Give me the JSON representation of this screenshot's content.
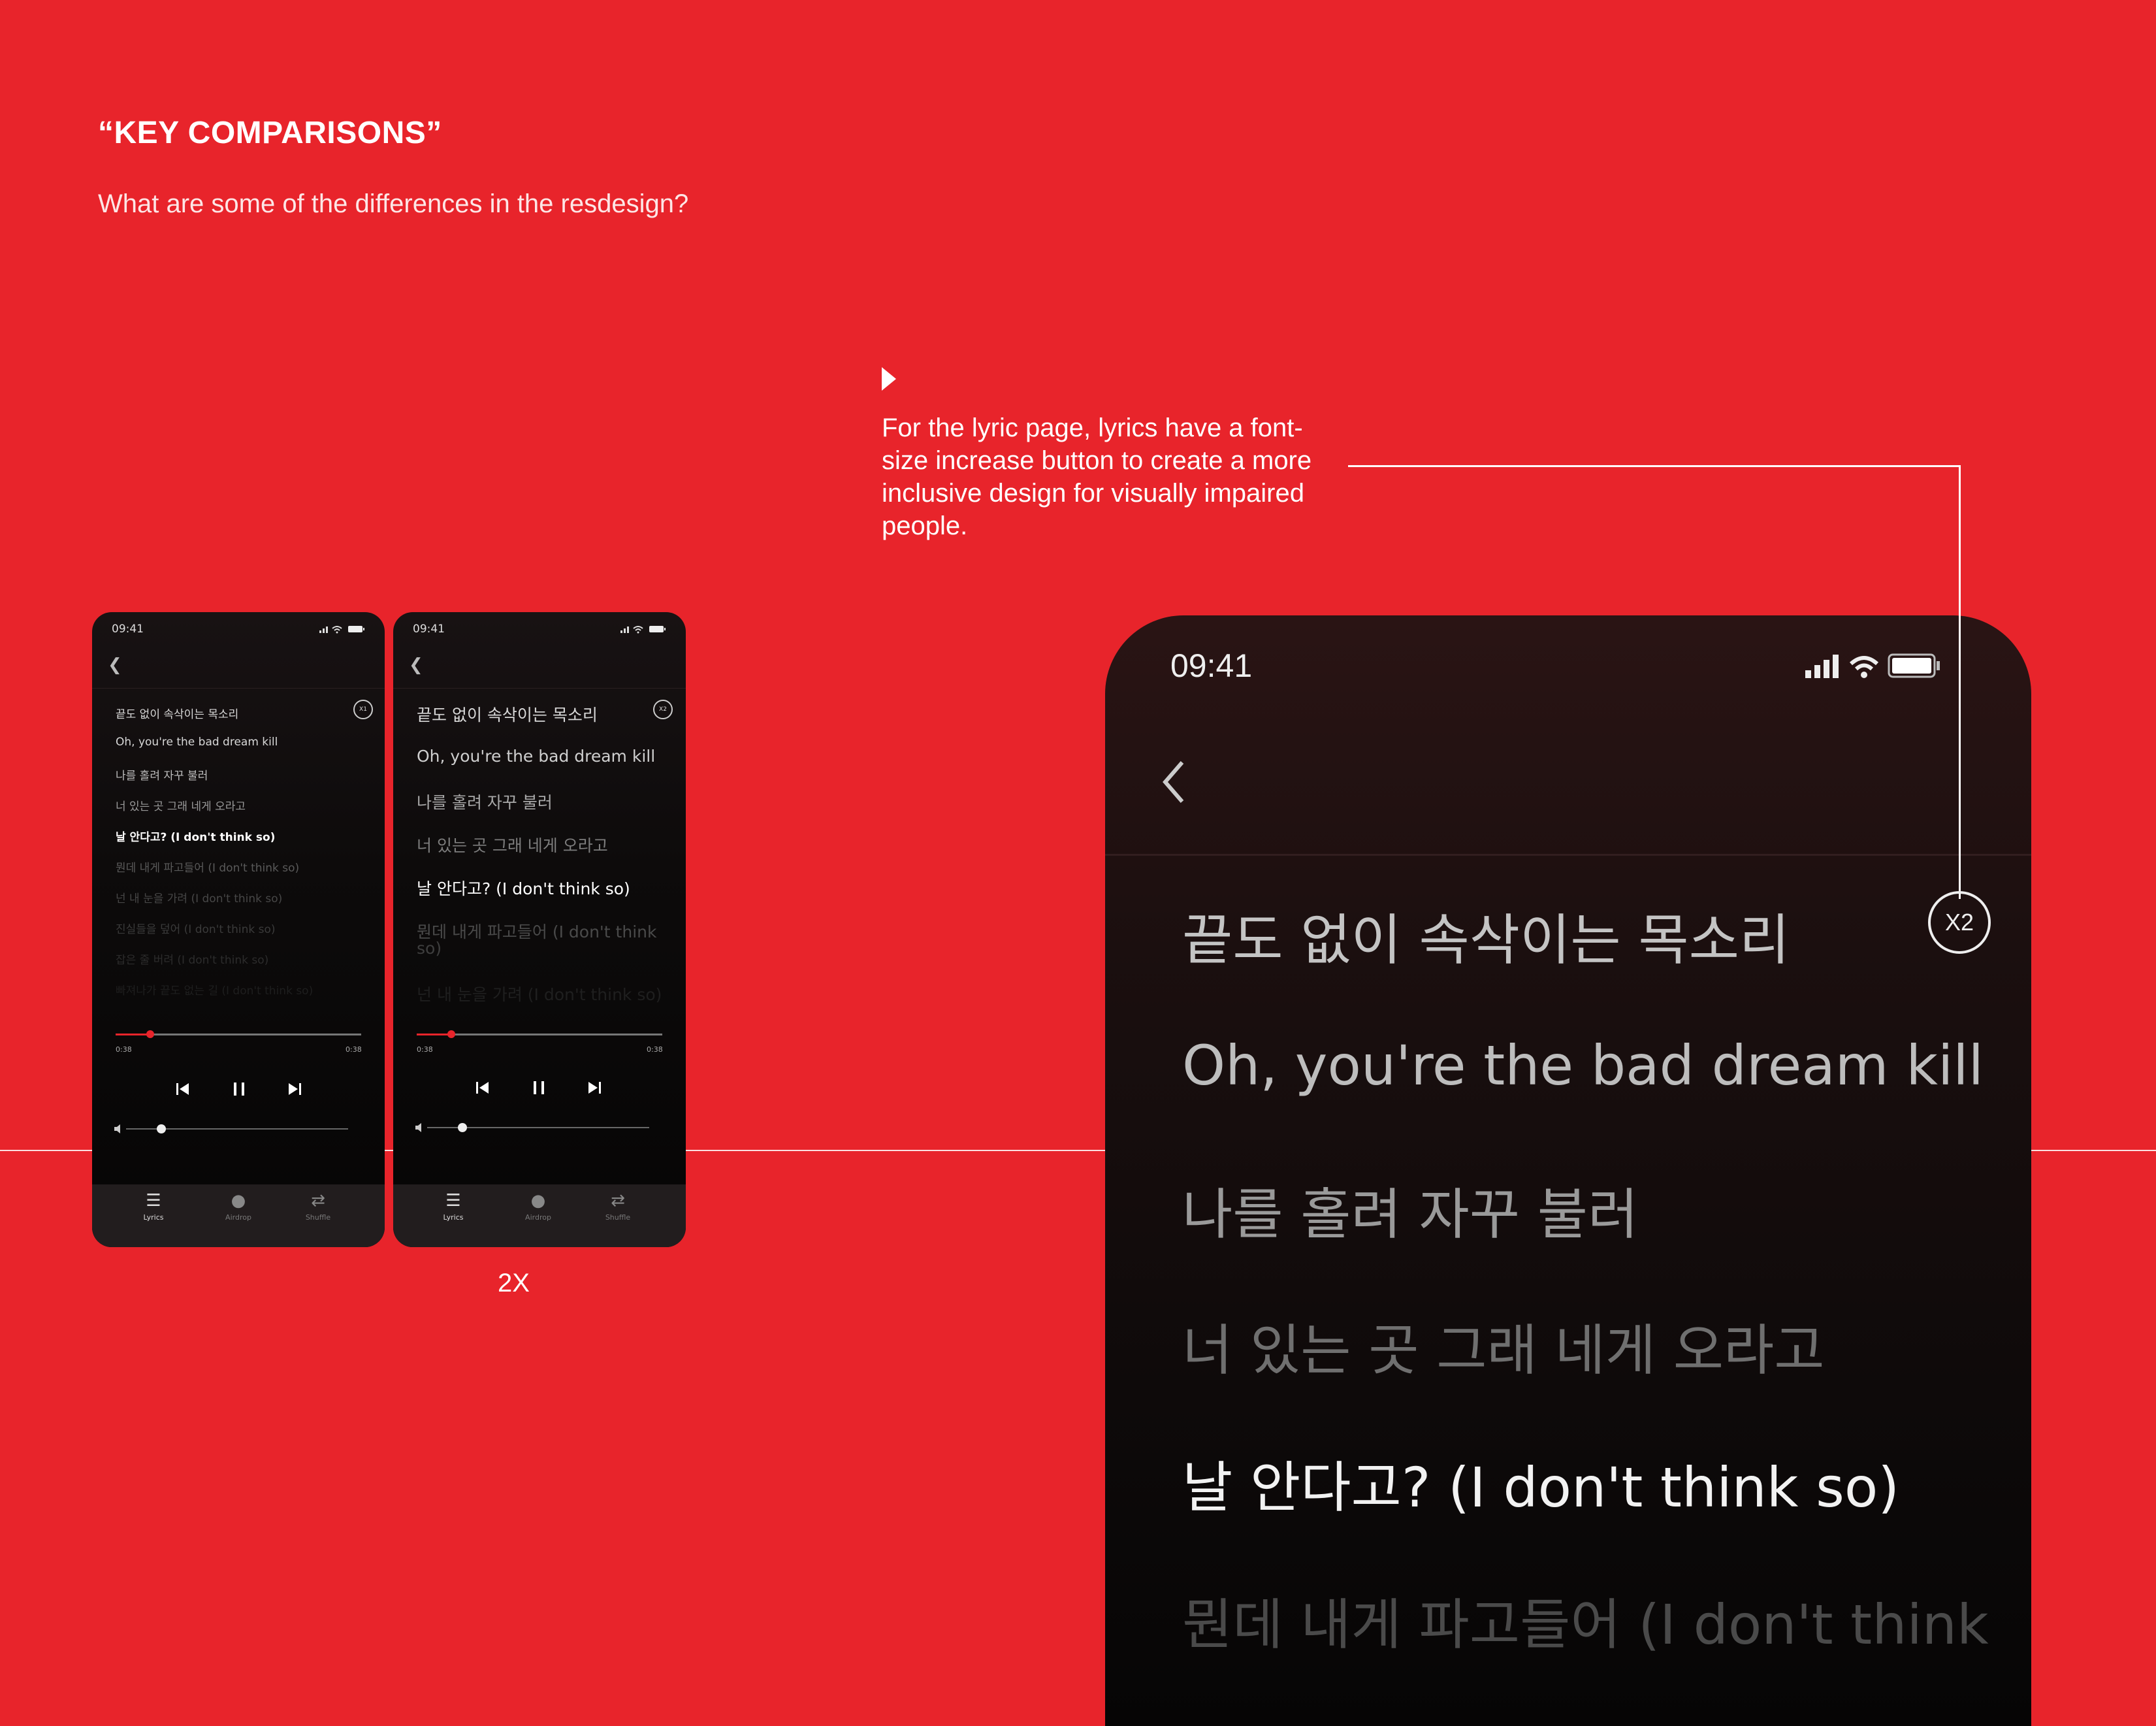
{
  "slide": {
    "title": "“KEY COMPARISONS”",
    "subtitle": "What are some of the differences in the resdesign?",
    "note": "For the lyric page, lyrics have a font-size increase button to create a more inclusive design for visually impaired people.",
    "caption": "2X"
  },
  "phone": {
    "time": "09:41",
    "elapsed": "0:38",
    "duration": "0:38",
    "tabs": [
      "Lyrics",
      "Airdrop",
      "Shuffle"
    ],
    "progress_fraction": 0.14,
    "volume_fraction": 0.16
  },
  "phone_1x": {
    "zoom_label": "X1",
    "lyrics": [
      "끝도 없이 속삭이는 목소리",
      "Oh, you're the bad dream kill",
      "나를 홀려 자꾸 불러",
      "너 있는 곳 그래 네게 오라고",
      "날 안다고? (I don't think so)",
      "뭔데 내게 파고들어 (I don't think so)",
      "넌 내 눈을 가려 (I don't think so)",
      "진실들을 덮어 (I don't think so)",
      "잡은 줄 버려 (I don't think so)",
      "빠져나가 끝도 없는 길 (I don't think so)"
    ]
  },
  "phone_2x": {
    "zoom_label": "X2",
    "lyrics": [
      "끝도 없이 속삭이는 목소리",
      "Oh, you're the bad dream kill",
      "나를 홀려 자꾸 불러",
      "너 있는 곳 그래 네게 오라고",
      "날 안다고? (I don't think so)",
      "뭔데 내게 파고들어 (I don't think",
      "so)",
      "넌 내 눈을 가려 (I don't think so)"
    ]
  },
  "big_phone": {
    "time": "09:41",
    "zoom_label": "X2",
    "lyrics": [
      "끝도 없이 속삭이는 목소리",
      "Oh, you're the bad dream kill",
      "나를 홀려 자꾸 불러",
      "너 있는 곳 그래 네게 오라고",
      "날 안다고? (I don't think so)",
      "뭔데 내게 파고들어 (I don't think"
    ]
  },
  "icons": [
    "back-icon",
    "signal-icon",
    "wifi-icon",
    "battery-icon",
    "previous-icon",
    "pause-icon",
    "next-icon",
    "volume-icon",
    "lyrics-icon",
    "airdrop-icon",
    "shuffle-icon"
  ],
  "colors": {
    "background": "#e8242b",
    "accent": "#e8242b",
    "phone_bg": "#0d0b0b",
    "tabbar_bg": "#221d1e"
  }
}
